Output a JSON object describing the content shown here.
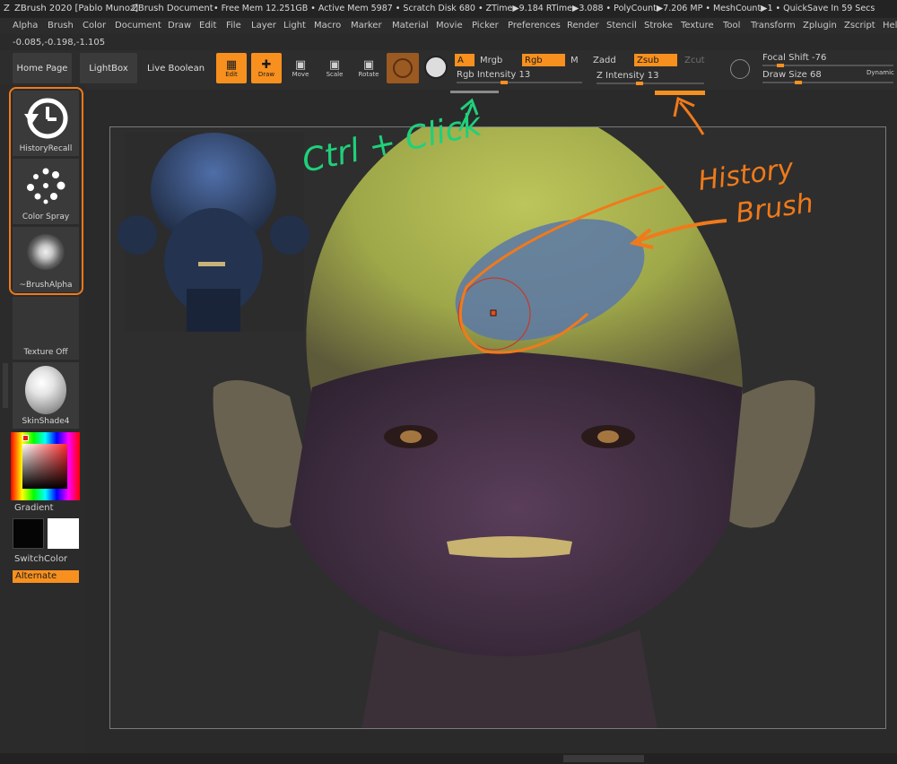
{
  "titlebar": {
    "app": "ZBrush 2020 [Pablo Munoz]",
    "doc": "ZBrush Document",
    "stats": "• Free Mem 12.251GB • Active Mem 5987 • Scratch Disk 680 •  ZTime▶9.184 RTime▶3.088 • PolyCount▶7.206 MP  • MeshCount▶1 • QuickSave In 59 Secs"
  },
  "menu": [
    "Alpha",
    "Brush",
    "Color",
    "Document",
    "Draw",
    "Edit",
    "File",
    "Layer",
    "Light",
    "Macro",
    "Marker",
    "Material",
    "Movie",
    "Picker",
    "Preferences",
    "Render",
    "Stencil",
    "Stroke",
    "Texture",
    "Tool",
    "Transform",
    "Zplugin",
    "Zscript",
    "Help"
  ],
  "coords": "-0.085,-0.198,-1.105",
  "toolbar": {
    "home_page": "Home Page",
    "lightbox": "LightBox",
    "live_boolean": "Live Boolean",
    "edit": "Edit",
    "draw": "Draw",
    "move": "Move",
    "scale": "Scale",
    "rotate": "Rotate",
    "a": "A",
    "mrgb": "Mrgb",
    "rgb": "Rgb",
    "m": "M",
    "zadd": "Zadd",
    "zsub": "Zsub",
    "zcut": "Zcut",
    "rgb_intensity": "Rgb Intensity 13",
    "z_intensity": "Z Intensity 13",
    "focal_shift": "Focal Shift -76",
    "draw_size": "Draw Size 68",
    "dynamic": "Dynamic"
  },
  "shelf": {
    "history_recall": "HistoryRecall",
    "color_spray": "Color Spray",
    "brush_alpha": "~BrushAlpha",
    "texture_off": "Texture Off",
    "material": "SkinShade4",
    "gradient": "Gradient",
    "switch_color": "SwitchColor",
    "alternate": "Alternate"
  },
  "annotations": {
    "ctrl_click": "Ctrl + Click",
    "history": "History",
    "brush": "Brush"
  },
  "colors": {
    "accent": "#f7901e",
    "annotation_orange": "#f07a1a",
    "annotation_green": "#1fd07a"
  }
}
